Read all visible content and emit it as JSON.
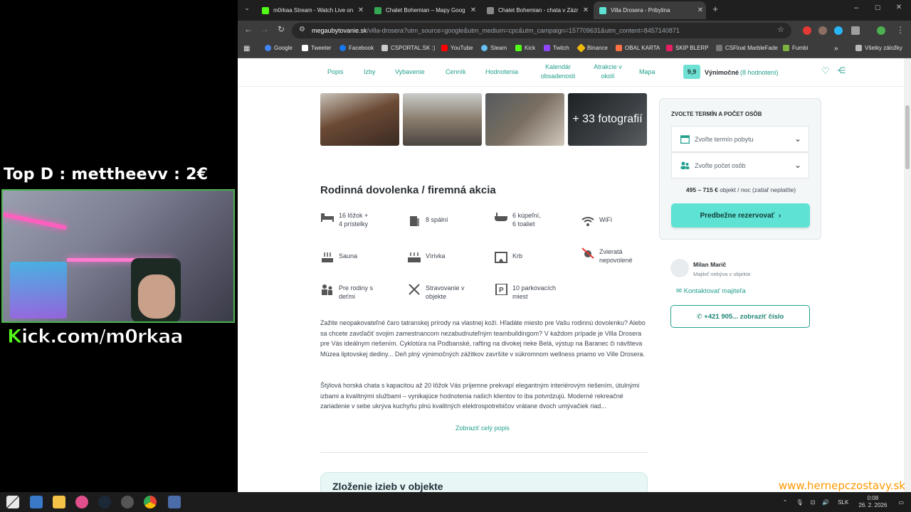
{
  "overlay": {
    "top_donation": "Top D : mettheevv : 2€",
    "kick_brand": "K",
    "kick_text": "ick.com/m0rkaa"
  },
  "browser": {
    "tabs": [
      {
        "title": "m0rkaa Stream - Watch Live on",
        "color": "#53fc18"
      },
      {
        "title": "Chalet Bohemian – Mapy Goog",
        "color": "#34a853"
      },
      {
        "title": "Chalet Bohemian - chata v Zázr",
        "color": "#888888"
      },
      {
        "title": "Villa Drosera - Pribylina",
        "color": "#5ee2d4"
      }
    ],
    "url_domain": "megaubytovanie.sk",
    "url_rest": "/villa-drosera?utm_source=google&utm_medium=cpc&utm_campaign=157709631&utm_content=8457140871",
    "bookmarks": [
      "Google",
      "Tweeter",
      "Facebook",
      "CSPORTAL.SK :)",
      "YouTube",
      "Steam",
      "Kick",
      "Twitch",
      "Binance",
      "OBAL KARTA",
      "SKIP BLERP",
      "CSFloat MarbleFade",
      "Fumbi"
    ],
    "all_bookmarks": "Všetky záložky"
  },
  "site_nav": {
    "items": [
      "Popis",
      "Izby",
      "Vybavenie",
      "Cenník",
      "Hodnotenia",
      "Kalendár obsadenosti",
      "Atrakcie v okolí",
      "Mapa"
    ],
    "score": "9,9",
    "score_label": "Výnimočné",
    "score_count": "(8 hodnotení)"
  },
  "gallery": {
    "more_label": "+ 33 fotografií"
  },
  "main": {
    "heading": "Rodinná dovolenka / firemná akcia",
    "features": [
      {
        "line1": "16 lôžok +",
        "line2": "4 prístelky",
        "icon": "bed-icon"
      },
      {
        "line1": "8 spální",
        "line2": "",
        "icon": "door-icon"
      },
      {
        "line1": "6 kúpeľní,",
        "line2": "6 toaliet",
        "icon": "bathtub-icon"
      },
      {
        "line1": "WiFi",
        "line2": "",
        "icon": "wifi-icon"
      },
      {
        "line1": "Sauna",
        "line2": "",
        "icon": "sauna-icon"
      },
      {
        "line1": "Vírivka",
        "line2": "",
        "icon": "hottub-icon"
      },
      {
        "line1": "Krb",
        "line2": "",
        "icon": "fireplace-icon"
      },
      {
        "line1": "Zvieratá",
        "line2": "nepovolené",
        "icon": "no-pets-icon"
      },
      {
        "line1": "Pre rodiny s",
        "line2": "deťmi",
        "icon": "family-icon"
      },
      {
        "line1": "Stravovanie v",
        "line2": "objekte",
        "icon": "cutlery-icon"
      },
      {
        "line1": "10 parkovacích",
        "line2": "miest",
        "icon": "parking-icon"
      }
    ],
    "paragraph1": "Zažite neopakovateľné čaro tatranskej prírody na vlastnej koži. Hľadáte miesto pre Vašu rodinnú dovolenku? Alebo sa chcete zavďačiť svojim zamestnancom nezabudnuteľným teambuildingom? V každom prípade je Villa Drosera pre Vás ideálnym riešením. Cyklotúra na Podbanské, rafting na divokej rieke Belá, výstup na Baranec či návšteva Múzea liptovskej dediny... Deň plný výnimočných zážitkov završíte v súkromnom wellness priamo vo Ville Drosera.",
    "paragraph2": "Štýlová horská chata s kapacitou až 20 lôžok Vás príjemne prekvapí elegantným interiérovým riešením, útulnými izbami a kvalitnými službami – vynikajúce hodnotenia našich klientov to iba potvrdzujú. Moderné rekreačné zariadenie v sebe ukrýva kuchyňu plnú kvalitných elektrospotrebičov vrátane dvoch umývačiek riad...",
    "show_all": "Zobraziť celý popis",
    "rooms_heading": "Zloženie izieb v objekte"
  },
  "booking": {
    "title": "ZVOĽTE TERMÍN A POČET OSÔB",
    "date_placeholder": "Zvoľte termín pobytu",
    "guests_placeholder": "Zvoľte počet osôb",
    "price_range": "495 – 715 €",
    "price_suffix": "objekt / noc (zatiaľ neplatíte)",
    "reserve_label": "Predbežne rezervovať"
  },
  "owner": {
    "name": "Milan Marič",
    "role": "Majiteľ nebýva v objekte",
    "contact_label": "Kontaktovať majiteľa",
    "phone_label": "+421 905... zobraziť číslo"
  },
  "taskbar": {
    "lang": "SLK",
    "time": "0:08",
    "date": "26. 2. 2026"
  },
  "watermark": "www.hernepczostavy.sk",
  "colors": {
    "accent": "#23a08e",
    "button": "#5ee2d4",
    "kick_green": "#53fc18"
  }
}
